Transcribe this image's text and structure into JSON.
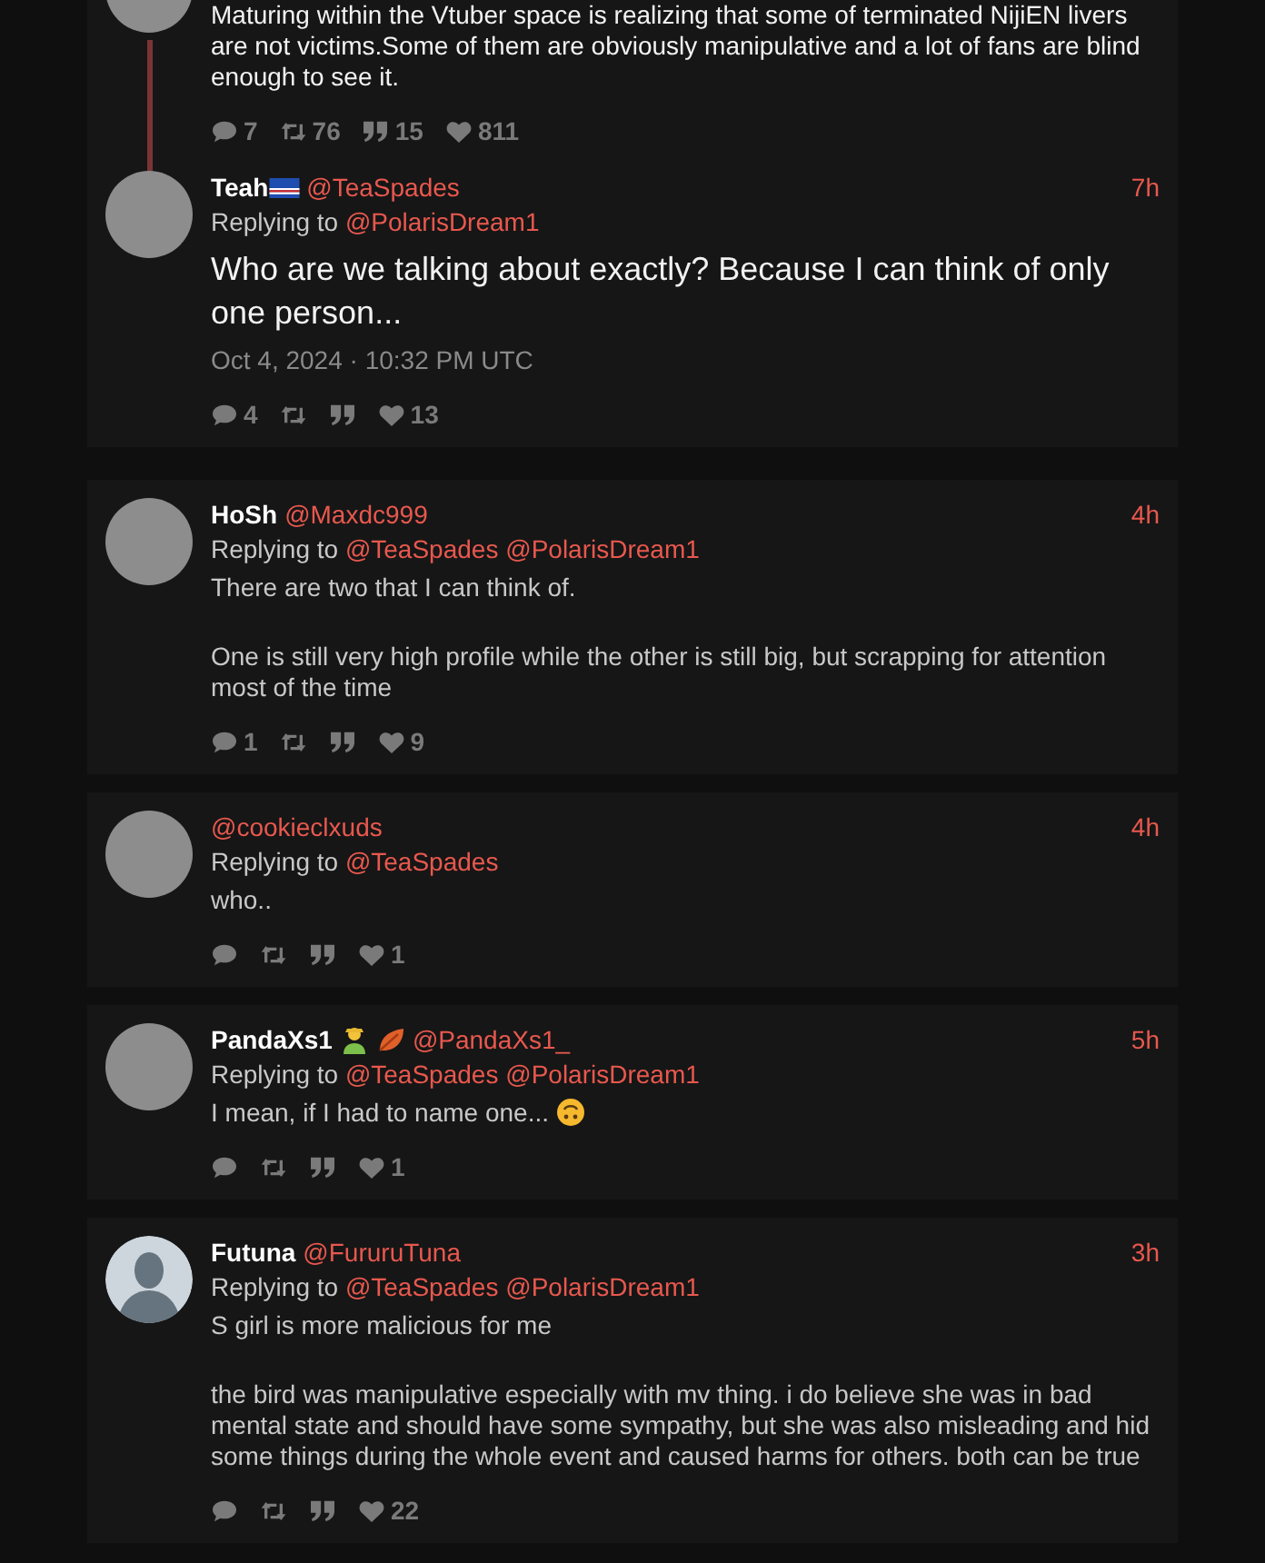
{
  "threads": [
    {
      "tweets": [
        {
          "kind": "cut",
          "avatar": {
            "kind": "photo"
          },
          "paragraphs": [
            "Maturing within the Vtuber space is realizing that some of terminated NijiEN livers are not victims.Some of them are obviously manipulative and a lot of fans are blind enough to see it."
          ],
          "stats": [
            {
              "kind": "replies",
              "count": "7"
            },
            {
              "kind": "retweets",
              "count": "76"
            },
            {
              "kind": "quotes",
              "count": "15"
            },
            {
              "kind": "likes",
              "count": "811"
            }
          ]
        },
        {
          "kind": "main",
          "avatar": {
            "kind": "photo"
          },
          "name": "Teah",
          "badges": [
            {
              "kind": "flag"
            }
          ],
          "handle": "@TeaSpades",
          "time": "7h",
          "reply_label": "Replying to",
          "replying_to": [
            "@PolarisDream1"
          ],
          "paragraphs": [
            "Who are we talking about exactly? Because I can think of only one person..."
          ],
          "date": "Oct 4, 2024 · 10:32 PM UTC",
          "stats": [
            {
              "kind": "replies",
              "count": "4"
            },
            {
              "kind": "retweets"
            },
            {
              "kind": "quotes"
            },
            {
              "kind": "likes",
              "count": "13"
            }
          ]
        }
      ]
    },
    {
      "tweets": [
        {
          "kind": "reply",
          "avatar": {
            "kind": "photo"
          },
          "name": "HoSh",
          "handle": "@Maxdc999",
          "time": "4h",
          "reply_label": "Replying to",
          "replying_to": [
            "@TeaSpades",
            "@PolarisDream1"
          ],
          "paragraphs": [
            "There are two that I can think of.",
            "One is still very high profile while the other is still big, but scrapping for attention most of the time"
          ],
          "stats": [
            {
              "kind": "replies",
              "count": "1"
            },
            {
              "kind": "retweets"
            },
            {
              "kind": "quotes"
            },
            {
              "kind": "likes",
              "count": "9"
            }
          ]
        }
      ]
    },
    {
      "tweets": [
        {
          "kind": "reply",
          "avatar": {
            "kind": "photo"
          },
          "handle": "@cookieclxuds",
          "time": "4h",
          "reply_label": "Replying to",
          "replying_to": [
            "@TeaSpades"
          ],
          "paragraphs": [
            "who.."
          ],
          "stats": [
            {
              "kind": "replies"
            },
            {
              "kind": "retweets"
            },
            {
              "kind": "quotes"
            },
            {
              "kind": "likes",
              "count": "1"
            }
          ]
        }
      ]
    },
    {
      "tweets": [
        {
          "kind": "reply",
          "avatar": {
            "kind": "photo"
          },
          "name": "PandaXs1",
          "badges": [
            {
              "kind": "person"
            },
            {
              "kind": "leaf"
            }
          ],
          "handle": "@PandaXs1_",
          "time": "5h",
          "reply_label": "Replying to",
          "replying_to": [
            "@TeaSpades",
            "@PolarisDream1"
          ],
          "paragraphs": [
            "I mean, if I had to name one..."
          ],
          "text_icon": {
            "kind": "upside-down-face"
          },
          "stats": [
            {
              "kind": "replies"
            },
            {
              "kind": "retweets"
            },
            {
              "kind": "quotes"
            },
            {
              "kind": "likes",
              "count": "1"
            }
          ]
        }
      ]
    },
    {
      "tweets": [
        {
          "kind": "reply",
          "avatar": {
            "kind": "default"
          },
          "name": "Futuna",
          "handle": "@FururuTuna",
          "time": "3h",
          "reply_label": "Replying to",
          "replying_to": [
            "@TeaSpades",
            "@PolarisDream1"
          ],
          "paragraphs": [
            "S girl is more malicious for me",
            "the bird was manipulative especially with mv thing. i do believe she was in bad mental state and should have some sympathy, but she was also misleading and hid some things during the whole event and caused harms for others. both can be true"
          ],
          "stats": [
            {
              "kind": "replies"
            },
            {
              "kind": "retweets"
            },
            {
              "kind": "quotes"
            },
            {
              "kind": "likes",
              "count": "22"
            }
          ]
        }
      ]
    }
  ]
}
